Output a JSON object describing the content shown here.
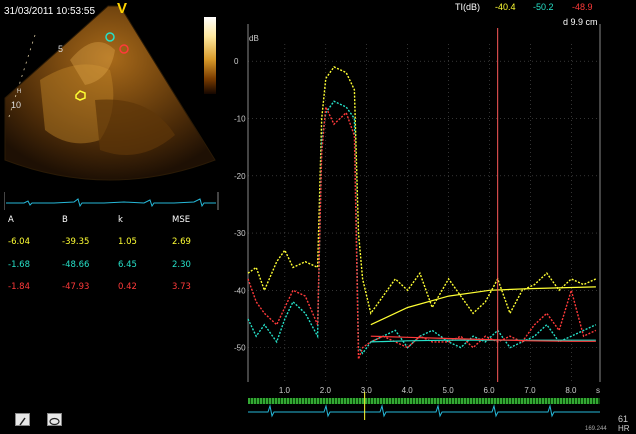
{
  "header": {
    "timestamp": "31/03/2011 10:53:55",
    "view_marker": "V",
    "ti_label": "TI(dB)",
    "ti_values": [
      "-40.4",
      "-50.2",
      "-48.9"
    ],
    "depth": "d 9.9 cm"
  },
  "image_panel": {
    "depth_ticks": [
      "5",
      "10"
    ],
    "depth_unit": "H"
  },
  "fit_table": {
    "headers": [
      "A",
      "B",
      "k",
      "MSE"
    ],
    "rows": [
      [
        "-6.04",
        "-39.35",
        "1.05",
        "2.69"
      ],
      [
        "-1.68",
        "-48.66",
        "6.45",
        "2.30"
      ],
      [
        "-1.84",
        "-47.93",
        "0.42",
        "3.73"
      ]
    ]
  },
  "colors": {
    "yellow": "#ffff33",
    "cyan": "#26e0c8",
    "red": "#ff3a3a",
    "marker": "#ff5a5a"
  },
  "chart_data": {
    "type": "line",
    "ylabel": "dB",
    "xlabel": "s",
    "xlim": [
      0.1,
      8.7
    ],
    "ylim": [
      -56,
      3
    ],
    "yticks": [
      0,
      -10,
      -20,
      -30,
      -40,
      -50
    ],
    "xticks": [
      1.0,
      2.0,
      3.0,
      4.0,
      5.0,
      6.0,
      7.0,
      8.0
    ],
    "ytick_labels": [
      "0",
      "-10",
      "-20",
      "-30",
      "-40",
      "-50"
    ],
    "xtick_labels": [
      "1.0",
      "2.0",
      "3.0",
      "4.0",
      "5.0",
      "6.0",
      "7.0",
      "8.0"
    ],
    "cursor_x": 6.2,
    "grid": true,
    "series": [
      {
        "color": "yellow",
        "x": [
          0.1,
          0.3,
          0.5,
          0.8,
          1.0,
          1.2,
          1.5,
          1.8,
          1.9,
          2.0,
          2.2,
          2.5,
          2.7,
          2.8,
          2.9,
          3.1,
          3.4,
          3.7,
          4.0,
          4.3,
          4.6,
          5.0,
          5.3,
          5.6,
          5.9,
          6.2,
          6.5,
          6.8,
          7.1,
          7.4,
          7.7,
          8.0,
          8.3,
          8.6
        ],
        "y": [
          -37,
          -36,
          -40,
          -35,
          -33,
          -36,
          -35,
          -36,
          -10,
          -3,
          -1,
          -2,
          -5,
          -30,
          -38,
          -44,
          -41,
          -38,
          -40,
          -37,
          -43,
          -38,
          -41,
          -44,
          -42,
          -38,
          -44,
          -40,
          -39,
          -37,
          -40,
          -38,
          -39,
          -38
        ]
      },
      {
        "color": "cyan",
        "x": [
          0.1,
          0.3,
          0.5,
          0.8,
          1.0,
          1.2,
          1.5,
          1.8,
          1.9,
          2.0,
          2.2,
          2.5,
          2.7,
          2.8,
          2.9,
          3.1,
          3.4,
          3.7,
          4.0,
          4.3,
          4.6,
          5.0,
          5.3,
          5.6,
          5.9,
          6.2,
          6.5,
          6.8,
          7.1,
          7.4,
          7.7,
          8.0,
          8.3,
          8.6
        ],
        "y": [
          -45,
          -48,
          -46,
          -49,
          -45,
          -42,
          -44,
          -48,
          -14,
          -9,
          -7,
          -8,
          -10,
          -50,
          -51,
          -49,
          -48,
          -47,
          -50,
          -48,
          -47,
          -49,
          -50,
          -48,
          -49,
          -47,
          -50,
          -49,
          -48,
          -46,
          -49,
          -48,
          -47,
          -46
        ]
      },
      {
        "color": "red",
        "x": [
          0.1,
          0.3,
          0.5,
          0.8,
          1.0,
          1.2,
          1.5,
          1.8,
          1.9,
          2.0,
          2.2,
          2.5,
          2.7,
          2.8,
          2.9,
          3.1,
          3.4,
          3.7,
          4.0,
          4.3,
          4.6,
          5.0,
          5.3,
          5.6,
          5.9,
          6.2,
          6.5,
          6.8,
          7.1,
          7.4,
          7.7,
          8.0,
          8.3,
          8.6
        ],
        "y": [
          -38,
          -42,
          -44,
          -46,
          -43,
          -40,
          -41,
          -46,
          -16,
          -8,
          -11,
          -9,
          -13,
          -52,
          -50,
          -49,
          -48,
          -49,
          -50,
          -48,
          -49,
          -49,
          -48,
          -50,
          -48,
          -49,
          -48,
          -49,
          -46,
          -44,
          -47,
          -40,
          -48,
          -47
        ]
      },
      {
        "color": "yellow",
        "x": [
          3.1,
          4.0,
          5.0,
          6.0,
          7.0,
          8.0,
          8.6
        ],
        "y": [
          -46,
          -43,
          -41,
          -40,
          -39.7,
          -39.5,
          -39.4
        ]
      },
      {
        "color": "cyan",
        "x": [
          3.1,
          4.0,
          5.0,
          6.0,
          7.0,
          8.0,
          8.6
        ],
        "y": [
          -49,
          -48.8,
          -48.7,
          -48.7,
          -48.7,
          -48.7,
          -48.7
        ]
      },
      {
        "color": "red",
        "x": [
          3.1,
          4.0,
          5.0,
          6.0,
          7.0,
          8.0,
          8.6
        ],
        "y": [
          -48,
          -48.2,
          -48.4,
          -48.6,
          -48.8,
          -48.9,
          -48.9
        ]
      }
    ]
  },
  "footer": {
    "hr_value": "61",
    "hr_label": "HR",
    "hr_code": "169.244"
  },
  "toolbar": {
    "pen_icon": "pen-icon",
    "oval_icon": "oval-icon"
  }
}
